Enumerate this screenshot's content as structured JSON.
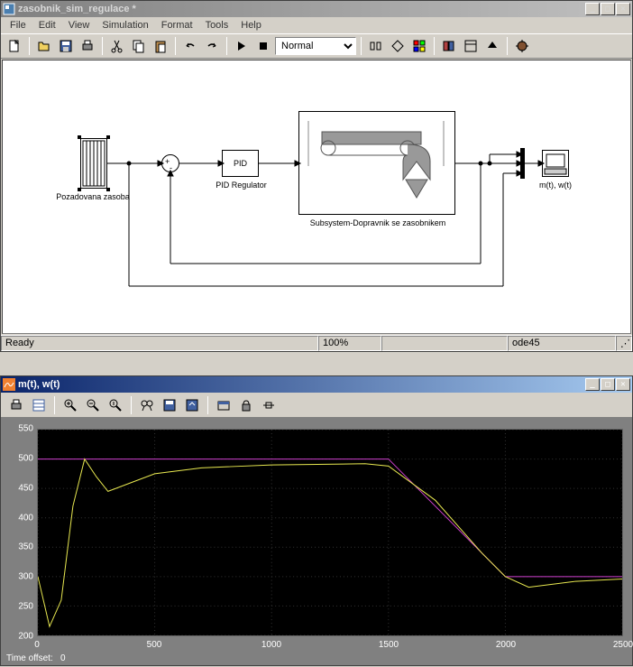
{
  "main_window": {
    "title": "zasobnik_sim_regulace *",
    "menus": [
      "File",
      "Edit",
      "View",
      "Simulation",
      "Format",
      "Tools",
      "Help"
    ],
    "sim_mode": "Normal",
    "status": {
      "ready": "Ready",
      "zoom": "100%",
      "solver": "ode45"
    }
  },
  "blocks": {
    "source_label": "Pozadovana zasoba",
    "pid_text": "PID",
    "pid_label": "PID Regulator",
    "subsystem_label": "Subsystem-Dopravnik se zasobnikem",
    "scope_label": "m(t), w(t)"
  },
  "scope_window": {
    "title": "m(t), w(t)",
    "time_offset_label": "Time offset:",
    "time_offset_value": "0"
  },
  "chart_data": {
    "type": "line",
    "xlabel": "",
    "ylabel": "",
    "xlim": [
      0,
      2500
    ],
    "ylim": [
      200,
      550
    ],
    "x_ticks": [
      0,
      500,
      1000,
      1500,
      2000,
      2500
    ],
    "y_ticks": [
      200,
      250,
      300,
      350,
      400,
      450,
      500,
      550
    ],
    "series": [
      {
        "name": "w(t)",
        "color": "#d040d0",
        "x": [
          0,
          1500,
          2000,
          2500
        ],
        "values": [
          500,
          500,
          300,
          300
        ]
      },
      {
        "name": "m(t)",
        "color": "#e8e850",
        "x": [
          0,
          50,
          100,
          150,
          200,
          250,
          300,
          400,
          500,
          700,
          1000,
          1400,
          1500,
          1700,
          1900,
          2000,
          2100,
          2300,
          2500
        ],
        "values": [
          300,
          215,
          260,
          420,
          500,
          470,
          445,
          460,
          475,
          485,
          490,
          492,
          488,
          430,
          340,
          300,
          282,
          292,
          296
        ]
      }
    ]
  }
}
